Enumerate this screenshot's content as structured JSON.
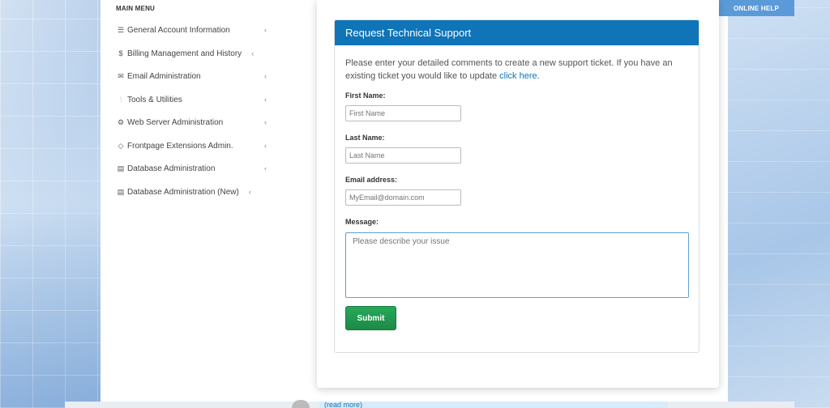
{
  "online_help_label": "ONLINE HELP",
  "sidebar": {
    "title": "MAIN MENU",
    "items": [
      {
        "label": "General Account Information",
        "icon": "list-icon"
      },
      {
        "label": "Billing Management and History",
        "icon": "dollar-icon"
      },
      {
        "label": "Email Administration",
        "icon": "envelope-icon"
      },
      {
        "label": "Tools & Utilities",
        "icon": "sliders-icon"
      },
      {
        "label": "Web Server Administration",
        "icon": "gear-icon"
      },
      {
        "label": "Frontpage Extensions Admin.",
        "icon": "tag-icon"
      },
      {
        "label": "Database Administration",
        "icon": "database-icon"
      },
      {
        "label": "Database Administration (New)",
        "icon": "database-icon"
      }
    ],
    "chevron": "‹"
  },
  "support": {
    "title": "Request Technical Support",
    "intro_text": "Please enter your detailed comments to create a new support ticket. If you have an existing ticket you would like to update ",
    "intro_link": "click here",
    "intro_end": ".",
    "first_name_label": "First Name:",
    "first_name_placeholder": "First Name",
    "last_name_label": "Last Name:",
    "last_name_placeholder": "Last Name",
    "email_label": "Email address:",
    "email_placeholder": "MyEmail@domain.com",
    "message_label": "Message:",
    "message_placeholder": "Please describe your issue",
    "submit_label": "Submit"
  },
  "footer": {
    "read_more": "(read more)"
  },
  "colors": {
    "header_blue": "#0f74b8",
    "submit_green": "#1c8a46",
    "online_help_bg": "#5b9ad8"
  }
}
